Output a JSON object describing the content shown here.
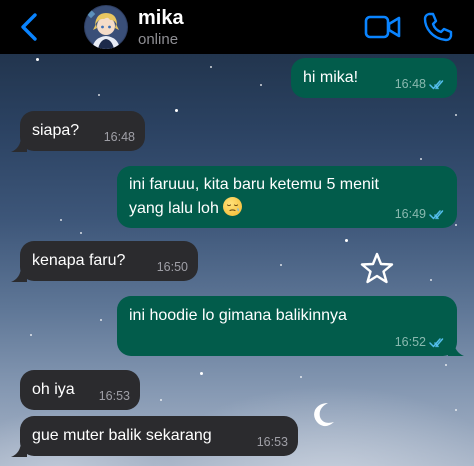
{
  "header": {
    "contact_name": "mika",
    "contact_status": "online",
    "icons": {
      "back": "chevron-left-icon",
      "video": "video-camera-icon",
      "call": "phone-icon"
    },
    "accent_color": "#0a84ff"
  },
  "messages": [
    {
      "direction": "outgoing",
      "text": "hi mika!",
      "time": "16:48",
      "read": true
    },
    {
      "direction": "incoming",
      "text": "siapa?",
      "time": "16:48"
    },
    {
      "direction": "outgoing",
      "lines": [
        "ini faruuu, kita baru ketemu 5 menit",
        "yang lalu loh"
      ],
      "emoji": "sleepy-face-emoji",
      "time": "16:49",
      "read": true
    },
    {
      "direction": "incoming",
      "text": "kenapa faru?",
      "time": "16:50"
    },
    {
      "direction": "outgoing",
      "text": "ini hoodie lo gimana balikinnya",
      "time": "16:52",
      "read": true
    },
    {
      "direction": "incoming",
      "text": "oh iya",
      "time": "16:53"
    },
    {
      "direction": "incoming",
      "text": "gue muter balik sekarang",
      "time": "16:53"
    }
  ],
  "colors": {
    "incoming_bubble": "#2b2b2e",
    "outgoing_bubble": "#025c4b",
    "read_tick": "#53bdeb"
  }
}
